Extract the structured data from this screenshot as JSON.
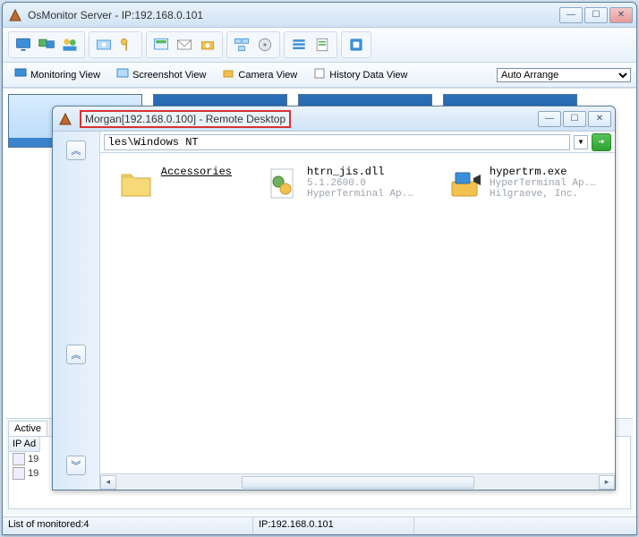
{
  "main_window": {
    "title": "OsMonitor Server -   IP:192.168.0.101",
    "view_tabs": {
      "monitoring": "Monitoring View",
      "screenshot": "Screenshot View",
      "camera": "Camera View",
      "history": "History Data View"
    },
    "arrange_selected": "Auto Arrange",
    "bottom_tab": "Active",
    "grid_header": "IP Ad",
    "grid_rows": [
      "19",
      "19"
    ]
  },
  "statusbar": {
    "monitored": "List of monitored:4",
    "ip": "IP:192.168.0.101"
  },
  "remote_window": {
    "title": "Morgan[192.168.0.100] - Remote Desktop",
    "path": "les\\Windows NT",
    "files": [
      {
        "name": "Accessories",
        "type": "folder"
      },
      {
        "name": "htrn_jis.dll",
        "line2": "5.1.2600.0",
        "line3": "HyperTerminal Ap...",
        "type": "dll"
      },
      {
        "name": "hypertrm.exe",
        "line2": "HyperTerminal Ap...",
        "line3": "Hilgraeve, Inc.",
        "type": "exe"
      }
    ]
  }
}
